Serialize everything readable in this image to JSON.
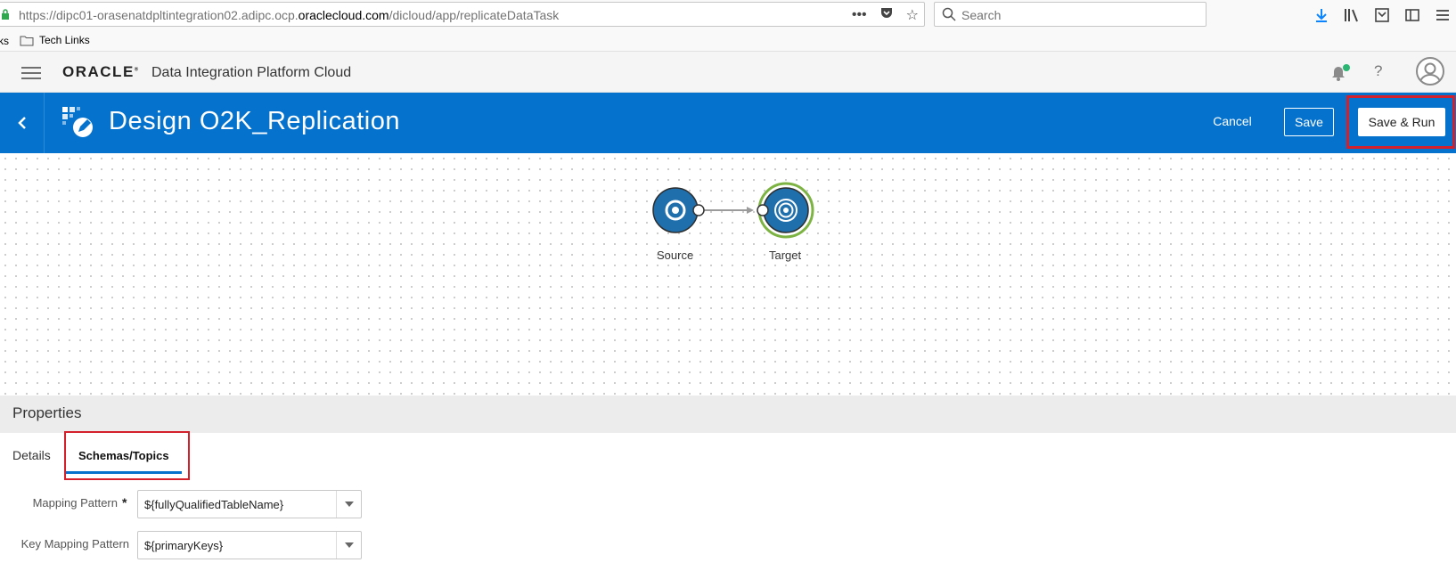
{
  "browser": {
    "url_prefix": "https://dipc01-orasenatdpltintegration02.adipc.ocp.",
    "url_domain": "oraclecloud.com",
    "url_suffix": "/dicloud/app/replicateDataTask",
    "search_placeholder": "Search",
    "bookmark_prev": "ks",
    "bookmark_item": "Tech Links"
  },
  "header": {
    "logo_text": "ORACLE",
    "app_name": "Data Integration Platform Cloud",
    "help_glyph": "?"
  },
  "titlebar": {
    "title": "Design O2K_Replication",
    "cancel_label": "Cancel",
    "save_label": "Save",
    "save_run_label": "Save & Run"
  },
  "canvas": {
    "nodes": [
      {
        "label": "Source"
      },
      {
        "label": "Target"
      }
    ]
  },
  "properties": {
    "title": "Properties",
    "tabs": [
      {
        "label": "Details"
      },
      {
        "label": "Schemas/Topics",
        "active": true
      }
    ],
    "fields": [
      {
        "label": "Mapping Pattern",
        "required_mark": "*",
        "value": "${fullyQualifiedTableName}"
      },
      {
        "label": "Key Mapping Pattern",
        "value": "${primaryKeys}"
      }
    ]
  },
  "colors": {
    "brand_blue": "#0572ce",
    "highlight_red": "#d3202b",
    "target_ring": "#7cb342",
    "notification_dot": "#2bb673"
  }
}
